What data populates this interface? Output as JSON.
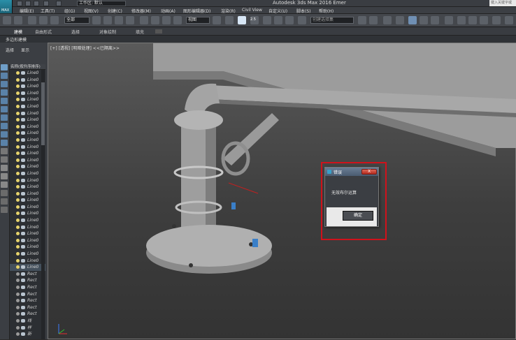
{
  "app": {
    "logo_text": "MAX",
    "workspace": "工作区: 默认",
    "title": "Autodesk 3ds Max 2016    Emer",
    "search_placeholder": "键入关键字或"
  },
  "menu": [
    "编辑(E)",
    "工具(T)",
    "组(G)",
    "视图(V)",
    "创建(C)",
    "修改器(M)",
    "动画(A)",
    "图形编辑器(D)",
    "渲染(R)",
    "Civil View",
    "自定义(U)",
    "脚本(S)",
    "帮助(H)"
  ],
  "toolbar": {
    "filter_value": "全部",
    "view_value": "视图",
    "snap_value": "2.5",
    "selection_set_placeholder": "创建选择集"
  },
  "ribbon_tabs": [
    "建模",
    "自由形式",
    "选择",
    "对象绘制",
    "填充"
  ],
  "subribbon": "多边形建模",
  "scene_explorer": {
    "tabs": [
      "选择",
      "显示"
    ],
    "header": "名称(按升序排序)",
    "rows": [
      {
        "label": "Line0",
        "type": "line"
      },
      {
        "label": "Line0",
        "type": "line"
      },
      {
        "label": "Line0",
        "type": "line"
      },
      {
        "label": "Line0",
        "type": "line"
      },
      {
        "label": "Line0",
        "type": "line"
      },
      {
        "label": "Line0",
        "type": "line"
      },
      {
        "label": "Line0",
        "type": "line"
      },
      {
        "label": "Line0",
        "type": "line"
      },
      {
        "label": "Line0",
        "type": "line"
      },
      {
        "label": "Line0",
        "type": "line"
      },
      {
        "label": "Line0",
        "type": "line"
      },
      {
        "label": "Line0",
        "type": "line"
      },
      {
        "label": "Line0",
        "type": "line"
      },
      {
        "label": "Line0",
        "type": "line"
      },
      {
        "label": "Line0",
        "type": "line"
      },
      {
        "label": "Line0",
        "type": "line"
      },
      {
        "label": "Line0",
        "type": "line"
      },
      {
        "label": "Line0",
        "type": "line"
      },
      {
        "label": "Line0",
        "type": "line"
      },
      {
        "label": "Line0",
        "type": "line"
      },
      {
        "label": "Line0",
        "type": "line"
      },
      {
        "label": "Line0",
        "type": "line"
      },
      {
        "label": "Line0",
        "type": "line"
      },
      {
        "label": "Line0",
        "type": "line"
      },
      {
        "label": "Line0",
        "type": "line"
      },
      {
        "label": "Line0",
        "type": "line"
      },
      {
        "label": "Line0",
        "type": "line"
      },
      {
        "label": "Line0",
        "type": "line"
      },
      {
        "label": "Line0",
        "type": "line"
      },
      {
        "label": "Line0",
        "type": "sel"
      },
      {
        "label": "Rect",
        "type": "rect"
      },
      {
        "label": "Rect",
        "type": "rect"
      },
      {
        "label": "Rect",
        "type": "rect"
      },
      {
        "label": "Rect",
        "type": "rect"
      },
      {
        "label": "Rect",
        "type": "rect"
      },
      {
        "label": "Rect",
        "type": "rect"
      },
      {
        "label": "Rect",
        "type": "rect"
      },
      {
        "label": "线",
        "type": "rect"
      },
      {
        "label": "样",
        "type": "rect"
      },
      {
        "label": "新",
        "type": "rect"
      }
    ]
  },
  "viewport": {
    "label": "[+] [透视] [明暗处理] <<已隔离>>"
  },
  "dialog": {
    "title": "错误",
    "close_label": "X",
    "message": "无效布尔运算",
    "ok_label": "确定"
  },
  "axis": {
    "x": "x",
    "y": "y",
    "z": "z"
  },
  "colors": {
    "highlight_frame": "#d0121b",
    "viewport_bg": "#4a4a4a",
    "panel_bg": "#3b3e43"
  }
}
